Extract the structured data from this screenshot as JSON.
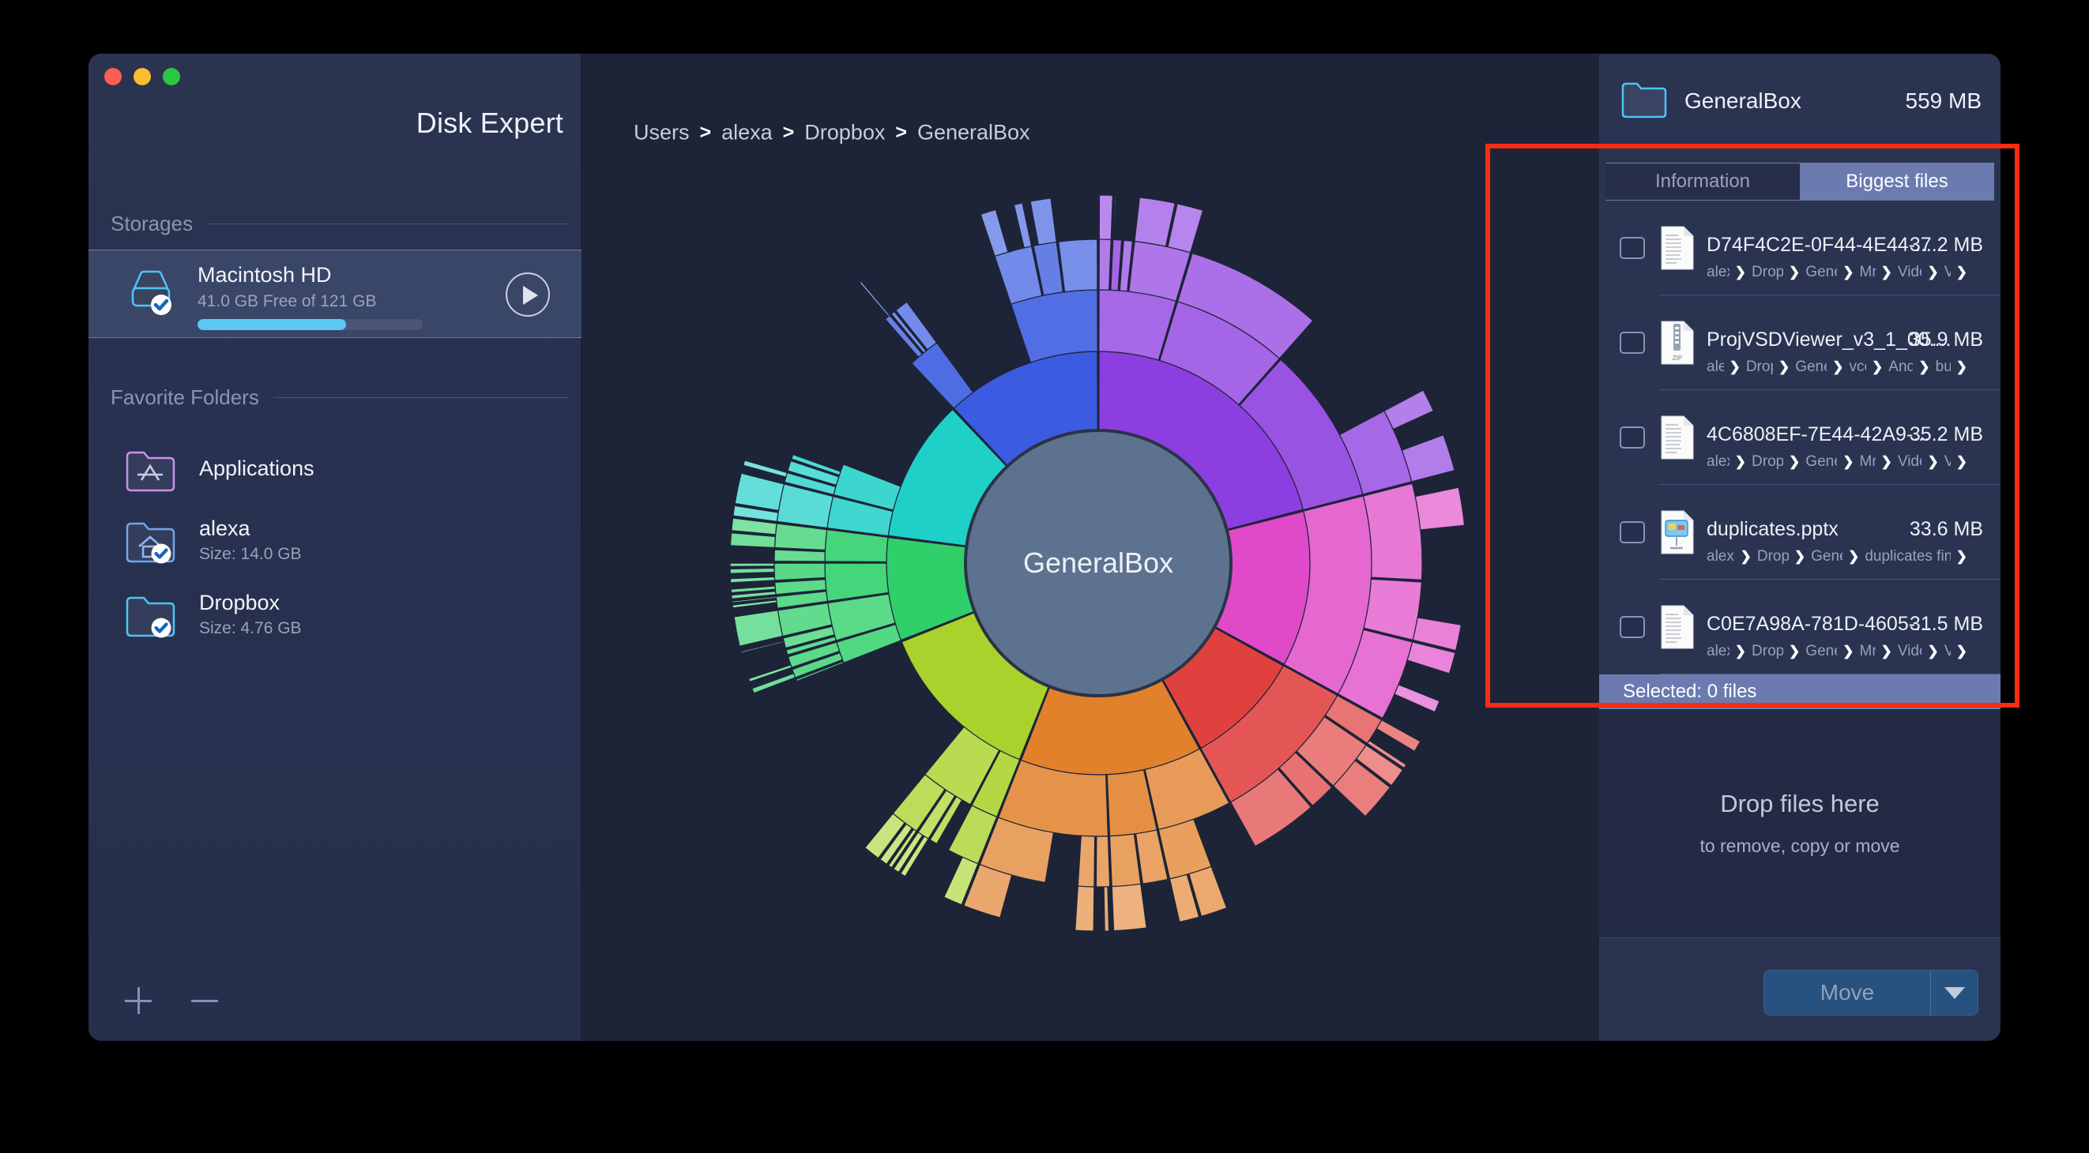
{
  "app": {
    "title": "Disk Expert"
  },
  "window_controls": {
    "close": "close",
    "minimize": "minimize",
    "zoom": "zoom"
  },
  "sidebar": {
    "storages_header": "Storages",
    "favorites_header": "Favorite Folders",
    "storage": {
      "name": "Macintosh HD",
      "detail": "41.0 GB Free of 121 GB",
      "used_percent": 66,
      "scan_button": "scan"
    },
    "favorites": [
      {
        "title": "Applications",
        "subtitle": ""
      },
      {
        "title": "alexa",
        "subtitle": "Size: 14.0 GB"
      },
      {
        "title": "Dropbox",
        "subtitle": "Size: 4.76 GB"
      }
    ],
    "add_label": "+",
    "remove_label": "–"
  },
  "breadcrumb": {
    "items": [
      "Users",
      "alexa",
      "Dropbox",
      "GeneralBox"
    ],
    "separator": "❯"
  },
  "chart_data": {
    "type": "pie",
    "title": "GeneralBox",
    "center_label": "GeneralBox",
    "rings": 4,
    "legend": "none",
    "series": [
      {
        "name": "ring1",
        "values": [
          21,
          12,
          9,
          14,
          13,
          8,
          11,
          12
        ]
      }
    ],
    "categories": [
      "violet",
      "magenta",
      "red",
      "orange",
      "yellow-green",
      "green",
      "teal",
      "blue"
    ],
    "colors": [
      "#8d3ee0",
      "#e049c8",
      "#e0413f",
      "#e2812c",
      "#a9d32c",
      "#2fd06a",
      "#1fd0c8",
      "#3b5ce0"
    ]
  },
  "right_panel": {
    "folder_name": "GeneralBox",
    "folder_size": "559 MB",
    "tabs": [
      {
        "label": "Information",
        "active": false
      },
      {
        "label": "Biggest files",
        "active": true
      }
    ],
    "files": [
      {
        "name": "D74F4C2E-0F44-4E44-...",
        "size": "37.2 MB",
        "icon": "document-icon",
        "path": [
          "alexa",
          "Dropbox",
          "GeneralBox",
          "Mrk",
          "Video",
          "V"
        ],
        "checked": false
      },
      {
        "name": "ProjVSDViewer_v3_1_00....",
        "size": "35.9 MB",
        "icon": "zip-icon",
        "path": [
          "alexa",
          "Dropbox",
          "GeneralBox",
          "vcom",
          "Android",
          "build"
        ],
        "checked": false
      },
      {
        "name": "4C6808EF-7E44-42A9-...",
        "size": "35.2 MB",
        "icon": "document-icon",
        "path": [
          "alexa",
          "Dropbox",
          "GeneralBox",
          "Mrk",
          "Video",
          "V"
        ],
        "checked": false
      },
      {
        "name": "duplicates.pptx",
        "size": "33.6 MB",
        "icon": "presentation-icon",
        "path": [
          "alexa",
          "Dropbox",
          "GeneralBox",
          "duplicates finder"
        ],
        "checked": false
      },
      {
        "name": "C0E7A98A-781D-4605-...",
        "size": "31.5 MB",
        "icon": "document-icon",
        "path": [
          "alexa",
          "Dropbox",
          "GeneralBox",
          "Mrk",
          "Video",
          "V"
        ],
        "checked": false
      }
    ],
    "selected_status": "Selected: 0 files",
    "drop_title": "Drop files here",
    "drop_subtitle": "to remove, copy or move",
    "move_button": "Move",
    "move_caret": "chevron-down"
  },
  "annotation": {
    "color": "#f92c12"
  }
}
